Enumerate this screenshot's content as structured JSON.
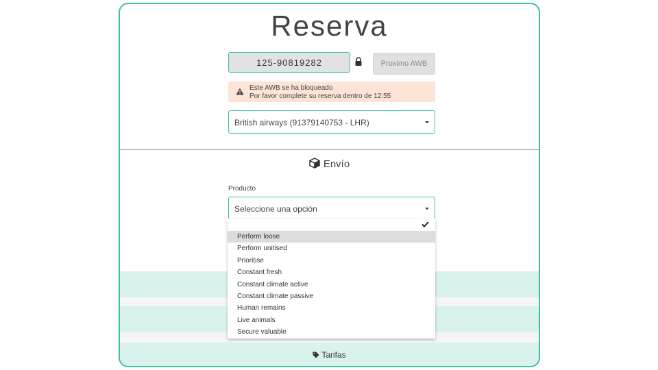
{
  "header": {
    "title": "Reserva"
  },
  "awb": {
    "value": "125-90819282",
    "next_button": "Proximo AWB"
  },
  "alert": {
    "line1": "Este AWB se ha bloqueado",
    "line2": "Por favor complete su reserva dentro de 12:55"
  },
  "airline_select": {
    "value": "British airways (91379140753 - LHR)"
  },
  "shipment": {
    "title": "Envío",
    "product_label": "Producto",
    "product_select": {
      "value": "Seleccione una opción"
    },
    "options": [
      "Perform loose",
      "Perform unitised",
      "Prioritise",
      "Constant fresh",
      "Constant climate active",
      "Constant climate passive",
      "Human remains",
      "Live animals",
      "Secure valuable"
    ],
    "highlighted_option": "Perform loose"
  },
  "footer": {
    "tarifas_label": "Tarifas"
  },
  "colors": {
    "accent": "#3dbfa8",
    "band": "#d9f2ee",
    "alert_bg": "#fde4d7"
  }
}
